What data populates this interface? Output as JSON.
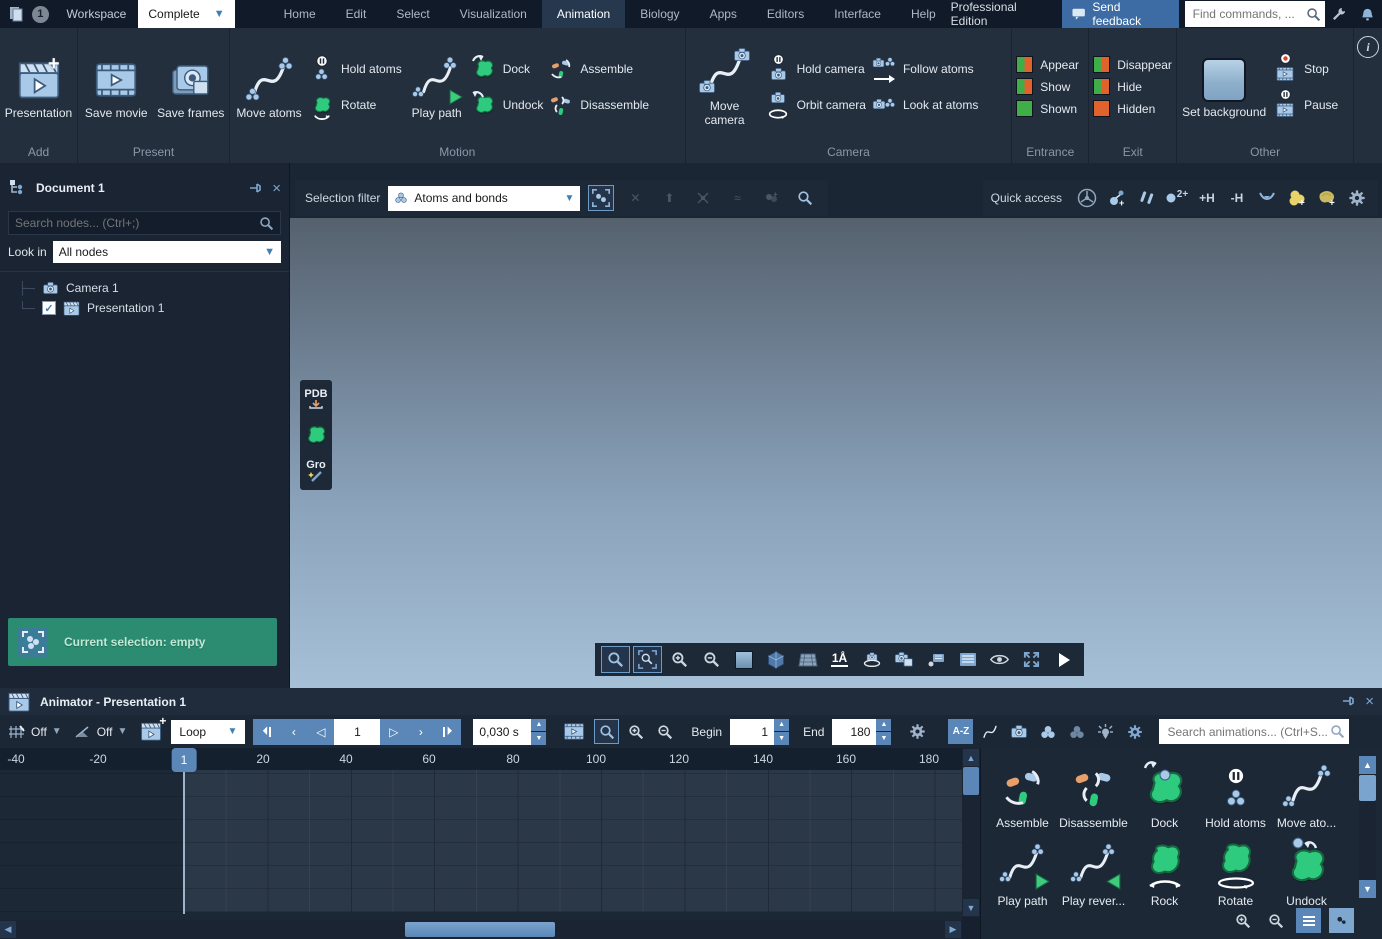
{
  "titlebar": {
    "badge": "1",
    "workspace_label": "Workspace",
    "workspace_value": "Complete",
    "menus": [
      "Home",
      "Edit",
      "Select",
      "Visualization",
      "Animation",
      "Biology",
      "Apps",
      "Editors",
      "Interface",
      "Help"
    ],
    "edition": "Professional Edition",
    "send_feedback": "Send feedback",
    "find_placeholder": "Find commands, ..."
  },
  "ribbon": {
    "add": {
      "label": "Add",
      "presentation": "Presentation"
    },
    "present": {
      "label": "Present",
      "save_movie": "Save movie",
      "save_frames": "Save frames"
    },
    "motion": {
      "label": "Motion",
      "move_atoms": "Move atoms",
      "hold_atoms": "Hold atoms",
      "rotate": "Rotate",
      "play_path": "Play path",
      "dock": "Dock",
      "undock": "Undock",
      "assemble": "Assemble",
      "disassemble": "Disassemble"
    },
    "camera": {
      "label": "Camera",
      "move_camera": "Move camera",
      "hold_camera": "Hold camera",
      "orbit_camera": "Orbit camera",
      "follow_atoms": "Follow atoms",
      "look_at_atoms": "Look at atoms"
    },
    "entrance": {
      "label": "Entrance",
      "appear": "Appear",
      "show": "Show",
      "shown": "Shown"
    },
    "exit": {
      "label": "Exit",
      "disappear": "Disappear",
      "hide": "Hide",
      "hidden": "Hidden"
    },
    "other": {
      "label": "Other",
      "set_background": "Set background",
      "stop": "Stop",
      "pause": "Pause"
    }
  },
  "document_panel": {
    "title": "Document 1",
    "search_placeholder": "Search nodes... (Ctrl+;)",
    "look_in_label": "Look in",
    "look_in_value": "All nodes",
    "nodes": [
      {
        "label": "Camera 1"
      },
      {
        "label": "Presentation 1"
      }
    ],
    "selection_banner": "Current selection: empty"
  },
  "viewport": {
    "selection_filter_label": "Selection filter",
    "selection_filter_value": "Atoms and bonds",
    "quick_access_label": "Quick access",
    "qa_charge": "2+",
    "qa_add_h": "+H",
    "qa_remove_h": "-H",
    "pdb_label": "PDB",
    "gro_label": "Gro",
    "scale_label": "1Å"
  },
  "animator": {
    "title": "Animator - Presentation 1",
    "grid_value": "Off",
    "snap_value": "Off",
    "play_mode": "Loop",
    "current_frame": "1",
    "frame_time": "0,030 s",
    "begin_label": "Begin",
    "begin_value": "1",
    "end_label": "End",
    "end_value": "180",
    "sort_label": "A-Z",
    "search_placeholder": "Search animations... (Ctrl+S...",
    "ruler": [
      "-40",
      "-20",
      "1",
      "20",
      "40",
      "60",
      "80",
      "100",
      "120",
      "140",
      "160",
      "180"
    ],
    "presets": [
      "Assemble",
      "Disassemble",
      "Dock",
      "Hold atoms",
      "Move ato...",
      "Play path",
      "Play rever...",
      "Rock",
      "Rotate",
      "Undock"
    ]
  },
  "colors": {
    "accent": "#5b87b8",
    "green": "#2ecb7e",
    "banner": "#2c8c71"
  }
}
